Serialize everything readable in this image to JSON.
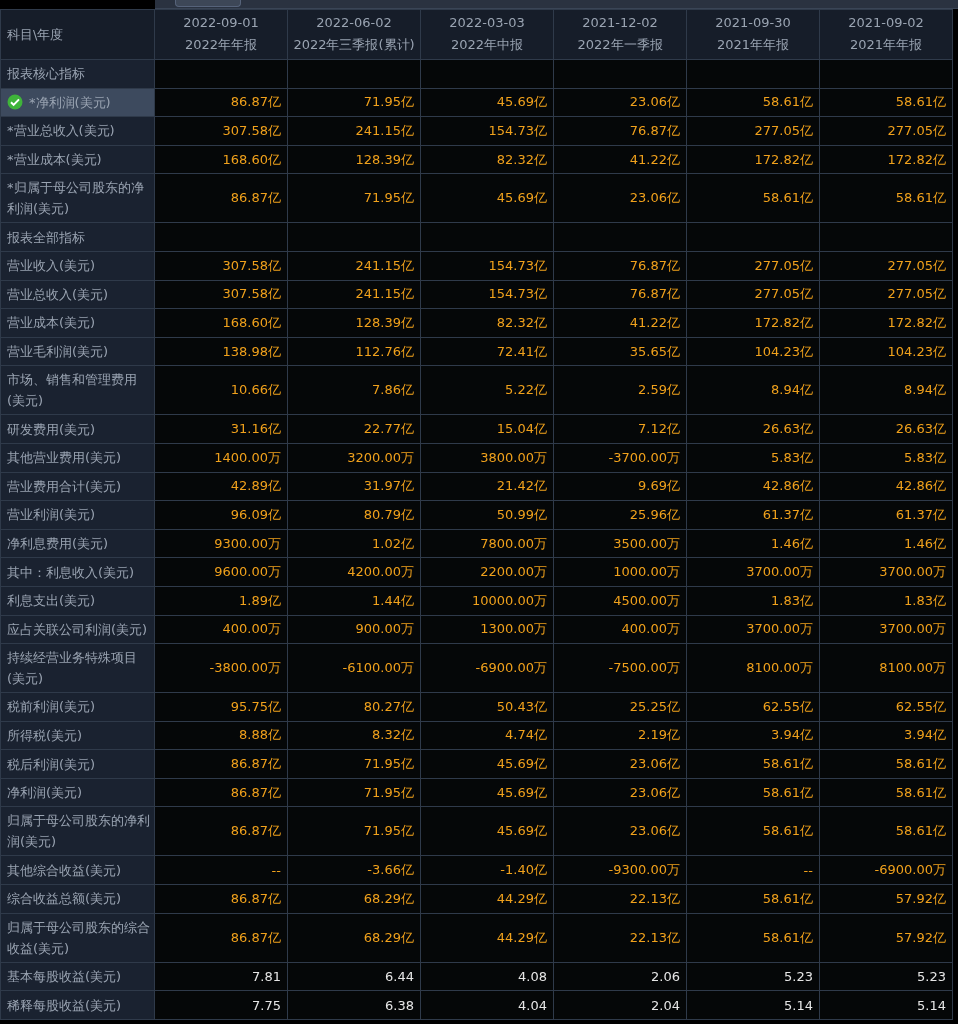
{
  "header": {
    "corner": "科目\\年度",
    "columns": [
      {
        "date": "2022-09-01",
        "report": "2022年年报"
      },
      {
        "date": "2022-06-02",
        "report": "2022年三季报(累计)"
      },
      {
        "date": "2022-03-03",
        "report": "2022年中报"
      },
      {
        "date": "2021-12-02",
        "report": "2022年一季报"
      },
      {
        "date": "2021-09-30",
        "report": "2021年年报"
      },
      {
        "date": "2021-09-02",
        "report": "2021年年报"
      }
    ]
  },
  "rows": [
    {
      "kind": "section",
      "label": "报表核心指标"
    },
    {
      "kind": "amount",
      "label": "*净利润(美元)",
      "selected": true,
      "values": [
        "86.87亿",
        "71.95亿",
        "45.69亿",
        "23.06亿",
        "58.61亿",
        "58.61亿"
      ]
    },
    {
      "kind": "amount",
      "label": "*营业总收入(美元)",
      "selected": false,
      "values": [
        "307.58亿",
        "241.15亿",
        "154.73亿",
        "76.87亿",
        "277.05亿",
        "277.05亿"
      ]
    },
    {
      "kind": "amount",
      "label": "*营业成本(美元)",
      "selected": false,
      "values": [
        "168.60亿",
        "128.39亿",
        "82.32亿",
        "41.22亿",
        "172.82亿",
        "172.82亿"
      ]
    },
    {
      "kind": "amount",
      "label": "*归属于母公司股东的净利润(美元)",
      "selected": false,
      "values": [
        "86.87亿",
        "71.95亿",
        "45.69亿",
        "23.06亿",
        "58.61亿",
        "58.61亿"
      ]
    },
    {
      "kind": "section",
      "label": "报表全部指标"
    },
    {
      "kind": "amount",
      "label": "营业收入(美元)",
      "selected": false,
      "values": [
        "307.58亿",
        "241.15亿",
        "154.73亿",
        "76.87亿",
        "277.05亿",
        "277.05亿"
      ]
    },
    {
      "kind": "amount",
      "label": "营业总收入(美元)",
      "selected": false,
      "values": [
        "307.58亿",
        "241.15亿",
        "154.73亿",
        "76.87亿",
        "277.05亿",
        "277.05亿"
      ]
    },
    {
      "kind": "amount",
      "label": "营业成本(美元)",
      "selected": false,
      "values": [
        "168.60亿",
        "128.39亿",
        "82.32亿",
        "41.22亿",
        "172.82亿",
        "172.82亿"
      ]
    },
    {
      "kind": "amount",
      "label": "营业毛利润(美元)",
      "selected": false,
      "values": [
        "138.98亿",
        "112.76亿",
        "72.41亿",
        "35.65亿",
        "104.23亿",
        "104.23亿"
      ]
    },
    {
      "kind": "amount",
      "label": "市场、销售和管理费用(美元)",
      "selected": false,
      "values": [
        "10.66亿",
        "7.86亿",
        "5.22亿",
        "2.59亿",
        "8.94亿",
        "8.94亿"
      ]
    },
    {
      "kind": "amount",
      "label": "研发费用(美元)",
      "selected": false,
      "values": [
        "31.16亿",
        "22.77亿",
        "15.04亿",
        "7.12亿",
        "26.63亿",
        "26.63亿"
      ]
    },
    {
      "kind": "amount",
      "label": "其他营业费用(美元)",
      "selected": false,
      "values": [
        "1400.00万",
        "3200.00万",
        "3800.00万",
        "-3700.00万",
        "5.83亿",
        "5.83亿"
      ]
    },
    {
      "kind": "amount",
      "label": "营业费用合计(美元)",
      "selected": false,
      "values": [
        "42.89亿",
        "31.97亿",
        "21.42亿",
        "9.69亿",
        "42.86亿",
        "42.86亿"
      ]
    },
    {
      "kind": "amount",
      "label": "营业利润(美元)",
      "selected": false,
      "values": [
        "96.09亿",
        "80.79亿",
        "50.99亿",
        "25.96亿",
        "61.37亿",
        "61.37亿"
      ]
    },
    {
      "kind": "amount",
      "label": "净利息费用(美元)",
      "selected": false,
      "values": [
        "9300.00万",
        "1.02亿",
        "7800.00万",
        "3500.00万",
        "1.46亿",
        "1.46亿"
      ]
    },
    {
      "kind": "amount",
      "label": "其中：利息收入(美元)",
      "selected": false,
      "values": [
        "9600.00万",
        "4200.00万",
        "2200.00万",
        "1000.00万",
        "3700.00万",
        "3700.00万"
      ]
    },
    {
      "kind": "amount",
      "label": "利息支出(美元)",
      "selected": false,
      "values": [
        "1.89亿",
        "1.44亿",
        "10000.00万",
        "4500.00万",
        "1.83亿",
        "1.83亿"
      ]
    },
    {
      "kind": "amount",
      "label": "应占关联公司利润(美元)",
      "selected": false,
      "values": [
        "400.00万",
        "900.00万",
        "1300.00万",
        "400.00万",
        "3700.00万",
        "3700.00万"
      ]
    },
    {
      "kind": "amount",
      "label": "持续经营业务特殊项目(美元)",
      "selected": false,
      "values": [
        "-3800.00万",
        "-6100.00万",
        "-6900.00万",
        "-7500.00万",
        "8100.00万",
        "8100.00万"
      ]
    },
    {
      "kind": "amount",
      "label": "税前利润(美元)",
      "selected": false,
      "values": [
        "95.75亿",
        "80.27亿",
        "50.43亿",
        "25.25亿",
        "62.55亿",
        "62.55亿"
      ]
    },
    {
      "kind": "amount",
      "label": "所得税(美元)",
      "selected": false,
      "values": [
        "8.88亿",
        "8.32亿",
        "4.74亿",
        "2.19亿",
        "3.94亿",
        "3.94亿"
      ]
    },
    {
      "kind": "amount",
      "label": "税后利润(美元)",
      "selected": false,
      "values": [
        "86.87亿",
        "71.95亿",
        "45.69亿",
        "23.06亿",
        "58.61亿",
        "58.61亿"
      ]
    },
    {
      "kind": "amount",
      "label": "净利润(美元)",
      "selected": false,
      "values": [
        "86.87亿",
        "71.95亿",
        "45.69亿",
        "23.06亿",
        "58.61亿",
        "58.61亿"
      ]
    },
    {
      "kind": "amount",
      "label": "归属于母公司股东的净利润(美元)",
      "selected": false,
      "values": [
        "86.87亿",
        "71.95亿",
        "45.69亿",
        "23.06亿",
        "58.61亿",
        "58.61亿"
      ]
    },
    {
      "kind": "amount",
      "label": "其他综合收益(美元)",
      "selected": false,
      "values": [
        "--",
        "-3.66亿",
        "-1.40亿",
        "-9300.00万",
        "--",
        "-6900.00万"
      ]
    },
    {
      "kind": "amount",
      "label": "综合收益总额(美元)",
      "selected": false,
      "values": [
        "86.87亿",
        "68.29亿",
        "44.29亿",
        "22.13亿",
        "58.61亿",
        "57.92亿"
      ]
    },
    {
      "kind": "amount",
      "label": "归属于母公司股东的综合收益(美元)",
      "selected": false,
      "values": [
        "86.87亿",
        "68.29亿",
        "44.29亿",
        "22.13亿",
        "58.61亿",
        "57.92亿"
      ]
    },
    {
      "kind": "per_share",
      "label": "基本每股收益(美元)",
      "selected": false,
      "values": [
        "7.81",
        "6.44",
        "4.08",
        "2.06",
        "5.23",
        "5.23"
      ]
    },
    {
      "kind": "per_share",
      "label": "稀释每股收益(美元)",
      "selected": false,
      "values": [
        "7.75",
        "6.38",
        "4.04",
        "2.04",
        "5.14",
        "5.14"
      ]
    }
  ]
}
